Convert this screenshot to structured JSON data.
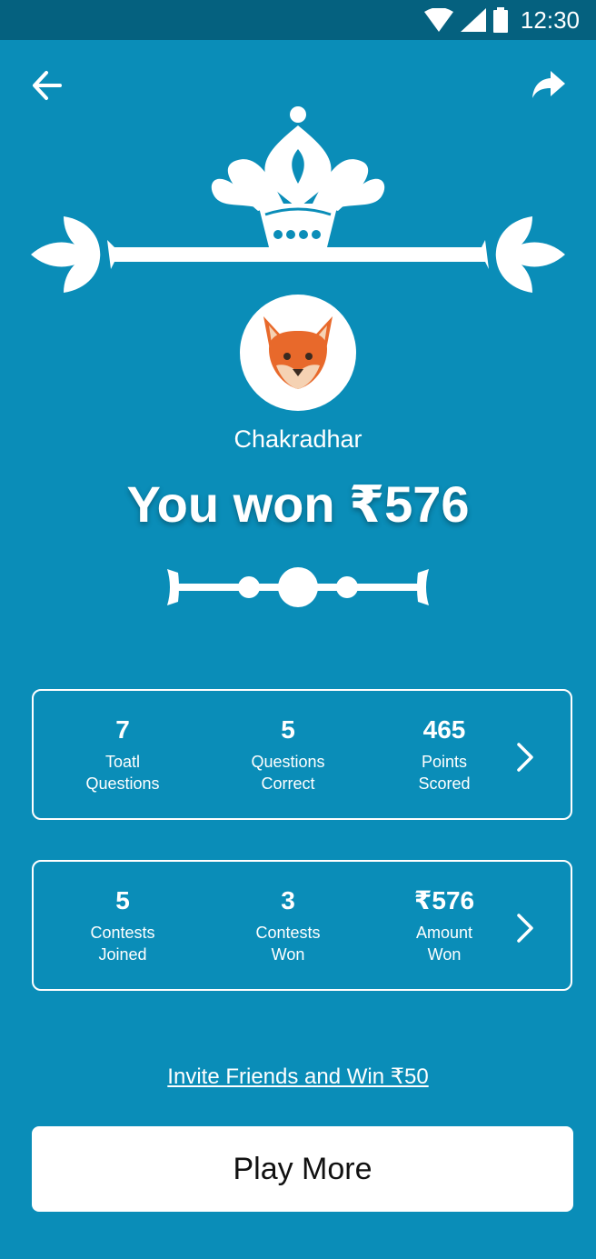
{
  "status_bar": {
    "time": "12:30"
  },
  "icons": {
    "back": "arrow-left-icon",
    "share": "share-icon",
    "crown": "crown-icon",
    "avatar": "fox-avatar-icon",
    "chevron": "chevron-right-icon"
  },
  "profile": {
    "username": "Chakradhar"
  },
  "result": {
    "title": "You won ₹576"
  },
  "quiz_stats": [
    {
      "value": "7",
      "label_line1": "Toatl",
      "label_line2": "Questions"
    },
    {
      "value": "5",
      "label_line1": "Questions",
      "label_line2": "Correct"
    },
    {
      "value": "465",
      "label_line1": "Points",
      "label_line2": "Scored"
    }
  ],
  "contest_stats": [
    {
      "value": "5",
      "label_line1": "Contests",
      "label_line2": "Joined"
    },
    {
      "value": "3",
      "label_line1": "Contests",
      "label_line2": "Won"
    },
    {
      "value": "₹576",
      "label_line1": "Amount",
      "label_line2": "Won"
    }
  ],
  "invite": {
    "label": "Invite Friends and Win ₹50"
  },
  "actions": {
    "play_more": "Play More"
  },
  "colors": {
    "background": "#0a8db8",
    "status_bar": "#05617f",
    "button": "#ffffff"
  }
}
